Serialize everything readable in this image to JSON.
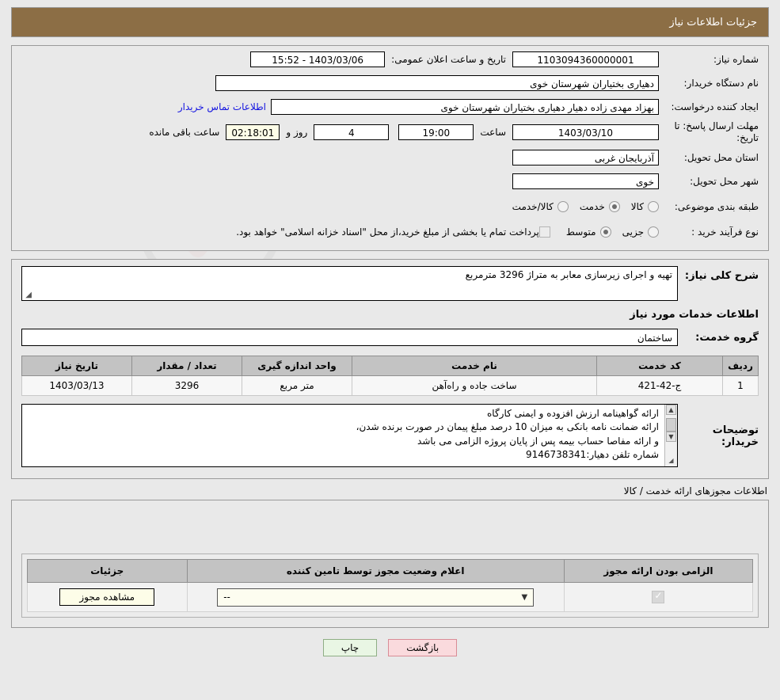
{
  "header": {
    "title": "جزئیات اطلاعات نیاز"
  },
  "form": {
    "need_number_label": "شماره نیاز:",
    "need_number_value": "1103094360000001",
    "public_announce_label": "تاریخ و ساعت اعلان عمومی:",
    "public_announce_value": "1403/03/06 - 15:52",
    "buyer_org_label": "نام دستگاه خریدار:",
    "buyer_org_value": "دهیاری بختیاران شهرستان خوی",
    "requester_label": "ایجاد کننده درخواست:",
    "requester_value": "بهزاد مهدی زاده دهیار دهیاری بختیاران شهرستان خوی",
    "contact_link": "اطلاعات تماس خریدار",
    "deadline_label": "مهلت ارسال پاسخ: تا تاریخ:",
    "deadline_date": "1403/03/10",
    "hour_label": "ساعت",
    "hour_value": "19:00",
    "days_value": "4",
    "days_label": "روز و",
    "countdown_value": "02:18:01",
    "countdown_label": "ساعت باقی مانده",
    "province_label": "استان محل تحویل:",
    "province_value": "آذربایجان غربی",
    "city_label": "شهر محل تحویل:",
    "city_value": "خوی",
    "category_label": "طبقه بندی موضوعی:",
    "category_options": [
      {
        "label": "کالا",
        "selected": false
      },
      {
        "label": "خدمت",
        "selected": true
      },
      {
        "label": "کالا/خدمت",
        "selected": false
      }
    ],
    "process_label": "نوع فرآیند خرید :",
    "process_options": [
      {
        "label": "جزیی",
        "selected": false
      },
      {
        "label": "متوسط",
        "selected": true
      }
    ],
    "payment_note": "پرداخت تمام یا بخشی از مبلغ خرید،از محل \"اسناد خزانه اسلامی\" خواهد بود."
  },
  "details": {
    "general_desc_label": "شرح کلی نیاز:",
    "general_desc_value": "تهیه و اجرای زیرسازی معابر به متراژ 3296 مترمربع",
    "services_info_title": "اطلاعات خدمات مورد نیاز",
    "service_group_label": "گروه خدمت:",
    "service_group_value": "ساختمان"
  },
  "items_table": {
    "columns": [
      "ردیف",
      "کد خدمت",
      "نام خدمت",
      "واحد اندازه گیری",
      "تعداد / مقدار",
      "تاریخ نیاز"
    ],
    "rows": [
      {
        "row": "1",
        "code": "ج-42-421",
        "name": "ساخت جاده و راه‌آهن",
        "unit": "متر مربع",
        "quantity": "3296",
        "date": "1403/03/13"
      }
    ]
  },
  "buyer_notes": {
    "label": "توضیحات خریدار:",
    "value": "ارائه گواهینامه ارزش افزوده و ایمنی کارگاه\nارائه ضمانت نامه بانکی به میزان 10 درصد مبلغ پیمان در صورت برنده شدن،\nو ارائه مفاصا حساب بیمه پس از پایان پروژه الزامی می باشد\nشماره تلفن دهیار:9146738341"
  },
  "licenses": {
    "caption": "اطلاعات مجوزهای ارائه خدمت / کالا",
    "columns": [
      "الزامی بودن ارائه مجوز",
      "اعلام وضعیت مجوز توسط تامین کننده",
      "جزئیات"
    ],
    "rows": [
      {
        "required": true,
        "status_value": "--",
        "detail_button": "مشاهده مجوز"
      }
    ]
  },
  "footer": {
    "back_label": "بازگشت",
    "print_label": "چاپ"
  },
  "watermark": {
    "text": "AriaTender.net"
  },
  "colors": {
    "header_bar": "#8c6e45",
    "link": "#1414e0",
    "back_button": "#fadadd",
    "print_button": "#e9f6e4",
    "cream_field": "#fdfde8"
  }
}
